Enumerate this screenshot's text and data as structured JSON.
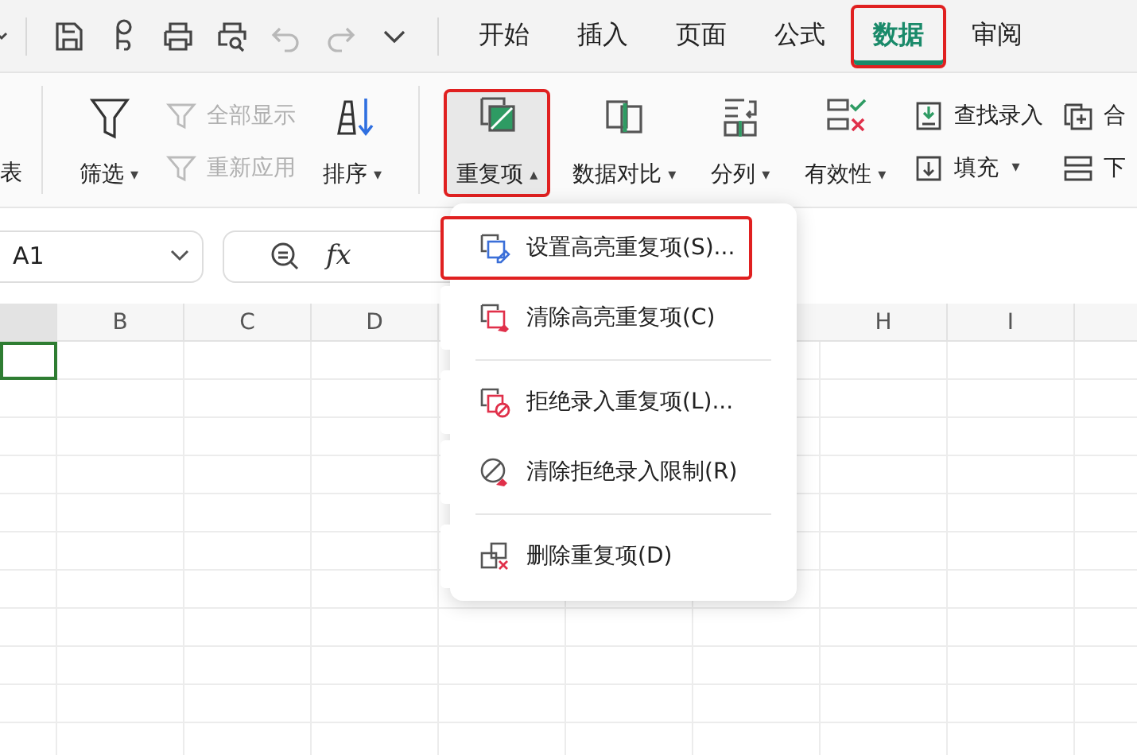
{
  "quick_access": [
    {
      "disabled": false
    },
    {
      "disabled": false
    },
    {
      "disabled": false
    },
    {
      "disabled": false
    },
    {
      "disabled": true
    },
    {
      "disabled": true
    },
    {
      "disabled": false
    }
  ],
  "tabs": [
    {
      "label": "开始",
      "selected": false,
      "highlighted": false
    },
    {
      "label": "插入",
      "selected": false,
      "highlighted": false
    },
    {
      "label": "页面",
      "selected": false,
      "highlighted": false
    },
    {
      "label": "公式",
      "selected": false,
      "highlighted": false
    },
    {
      "label": "数据",
      "selected": true,
      "highlighted": true
    },
    {
      "label": "审阅",
      "selected": false,
      "highlighted": false
    }
  ],
  "ribbon": [
    {
      "kind": "cut",
      "label": "表"
    },
    {
      "kind": "divider"
    },
    {
      "kind": "large",
      "label": "筛选",
      "caret": "▾",
      "active": false,
      "highlighted": false
    },
    {
      "kind": "pair",
      "items": [
        {
          "label": "全部显示",
          "disabled": true
        },
        {
          "label": "重新应用",
          "disabled": true
        }
      ]
    },
    {
      "kind": "large",
      "label": "排序",
      "caret": "▾",
      "active": false,
      "highlighted": false
    },
    {
      "kind": "divider"
    },
    {
      "kind": "large",
      "label": "重复项",
      "caret": "▴",
      "active": true,
      "highlighted": true
    },
    {
      "kind": "large",
      "label": "数据对比",
      "caret": "▾",
      "active": false,
      "highlighted": false
    },
    {
      "kind": "large",
      "label": "分列",
      "caret": "▾",
      "active": false,
      "highlighted": false
    },
    {
      "kind": "large",
      "label": "有效性",
      "caret": "▾",
      "active": false,
      "highlighted": false
    },
    {
      "kind": "pair",
      "items": [
        {
          "label": "查找录入",
          "disabled": false
        },
        {
          "label": "填充",
          "caret": "▾",
          "disabled": false
        }
      ]
    },
    {
      "kind": "pair",
      "items": [
        {
          "label": "合",
          "disabled": false
        },
        {
          "label": "下",
          "disabled": false
        }
      ]
    }
  ],
  "name_box": {
    "value": "A1"
  },
  "formula_bar": {
    "fx": "fx"
  },
  "columns": [
    {
      "selected": true
    },
    {
      "label": "B",
      "selected": false
    },
    {
      "label": "C",
      "selected": false
    },
    {
      "label": "D",
      "selected": false
    },
    {
      "label": "H",
      "selected": false
    },
    {
      "label": "I",
      "selected": false
    }
  ],
  "menu": [
    {
      "label": "设置高亮重复项(S)...",
      "highlighted": true,
      "separator_after": false
    },
    {
      "label": "清除高亮重复项(C)",
      "highlighted": false,
      "separator_after": true
    },
    {
      "label": "拒绝录入重复项(L)...",
      "highlighted": false,
      "separator_after": false
    },
    {
      "label": "清除拒绝录入限制(R)",
      "highlighted": false,
      "separator_after": true
    },
    {
      "label": "删除重复项(D)",
      "highlighted": false,
      "separator_after": false
    }
  ]
}
